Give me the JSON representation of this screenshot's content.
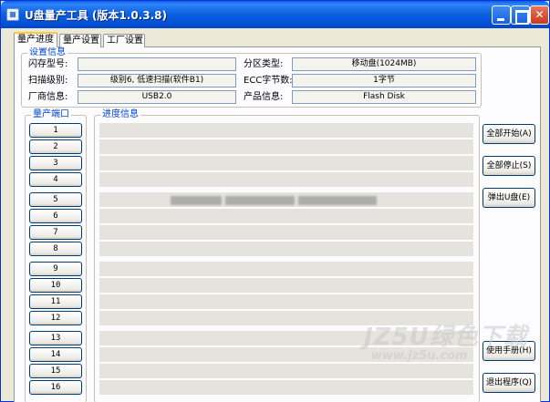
{
  "window": {
    "title": "U盘量产工具 (版本1.0.3.8)"
  },
  "tabs": [
    {
      "label": "量产进度",
      "active": true
    },
    {
      "label": "量产设置",
      "active": false
    },
    {
      "label": "工厂设置",
      "active": false
    }
  ],
  "settings": {
    "group_title": "设置信息",
    "flash_model_label": "闪存型号:",
    "flash_model_value": "",
    "scan_level_label": "扫描级别:",
    "scan_level_value": "级别6, 低速扫描(软件B1)",
    "vendor_label": "厂商信息:",
    "vendor_value": "USB2.0",
    "partition_type_label": "分区类型:",
    "partition_type_value": "移动盘(1024MB)",
    "ecc_label": "ECC字节数:",
    "ecc_value": "1字节",
    "product_label": "产品信息:",
    "product_value": "Flash Disk"
  },
  "ports": {
    "group_title": "量产端口",
    "items": [
      "1",
      "2",
      "3",
      "4",
      "5",
      "6",
      "7",
      "8",
      "9",
      "10",
      "11",
      "12",
      "13",
      "14",
      "15",
      "16"
    ]
  },
  "progress": {
    "group_title": "进度信息"
  },
  "actions": {
    "start_all": "全部开始(A)",
    "stop_all": "全部停止(S)",
    "eject_usb": "弹出U盘(E)",
    "manual": "使用手册(H)",
    "exit": "退出程序(Q)"
  },
  "watermark": {
    "line1": "JZ5U绿色下载",
    "line2": "www.jz5u.com"
  },
  "colors": {
    "titlebar": "#0a5fe0",
    "group_title": "#0046d5",
    "progress_track": "#e4e3dd"
  }
}
